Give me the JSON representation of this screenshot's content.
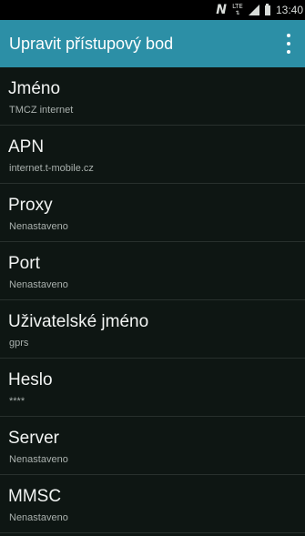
{
  "status_bar": {
    "lte_label": "LTE",
    "time": "13:40",
    "icons": [
      "nfc-icon",
      "lte-icon",
      "signal-icon",
      "battery-icon"
    ]
  },
  "action_bar": {
    "title": "Upravit přístupový bod",
    "menu_icon": "overflow-menu-icon"
  },
  "colors": {
    "action_bar": "#2c8fa6",
    "background": "#0e1613",
    "title_text": "#f2f4f3",
    "value_text": "#a9b0ad",
    "divider": "#28302d"
  },
  "settings": [
    {
      "title": "Jméno",
      "value": "TMCZ internet"
    },
    {
      "title": "APN",
      "value": "internet.t-mobile.cz"
    },
    {
      "title": "Proxy",
      "value": "Nenastaveno"
    },
    {
      "title": "Port",
      "value": "Nenastaveno"
    },
    {
      "title": "Uživatelské jméno",
      "value": "gprs"
    },
    {
      "title": "Heslo",
      "value": "****"
    },
    {
      "title": "Server",
      "value": "Nenastaveno"
    },
    {
      "title": "MMSC",
      "value": "Nenastaveno"
    }
  ]
}
